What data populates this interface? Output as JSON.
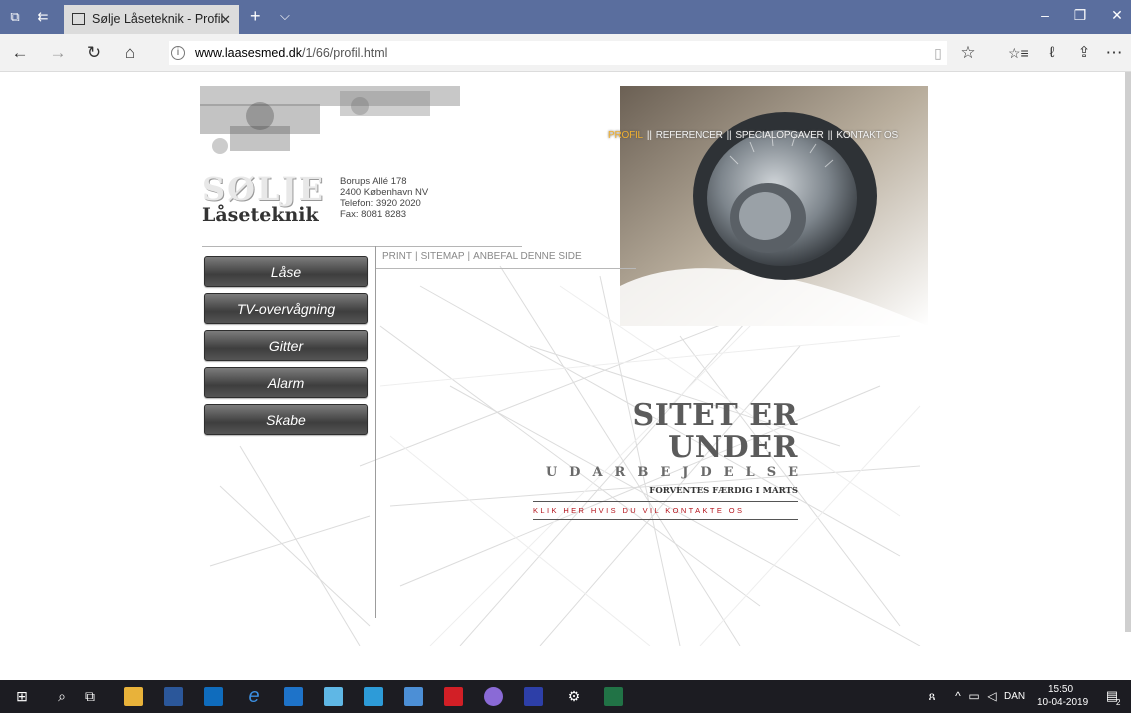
{
  "browser": {
    "tab_title": "Sølje Låseteknik - Profil",
    "url_host": "www.laasesmed.dk",
    "url_path": "/1/66/profil.html"
  },
  "site": {
    "logo_name": "SØLJE",
    "logo_brand": "Låseteknik",
    "address": [
      "Borups Allé 178",
      "2400 København NV",
      "Telefon: 3920 2020",
      "Fax: 8081 8283"
    ],
    "top_nav": [
      "PROFIL",
      "REFERENCER",
      "SPECIALOPGAVER",
      "KONTAKT OS"
    ],
    "util_links": [
      "PRINT",
      "SITEMAP",
      "ANBEFAL DENNE SIDE"
    ],
    "side_menu": [
      "Låse",
      "TV-overvågning",
      "Gitter",
      "Alarm",
      "Skabe"
    ],
    "construction": {
      "title": "SITET ER UNDER",
      "subtitle": "UDARBEJDELSE",
      "date_note": "FORVENTES FÆRDIG I MARTS",
      "contact_link": "KLIK HER HVIS DU VIL KONTAKTE OS"
    }
  },
  "taskbar": {
    "language": "DAN",
    "time": "15:50",
    "date": "10-04-2019",
    "notification_count": "2"
  },
  "colors": {
    "chrome_tab_bar": "#5a6e9e",
    "active_nav": "#f0b030",
    "contact_link": "#b3131b"
  }
}
